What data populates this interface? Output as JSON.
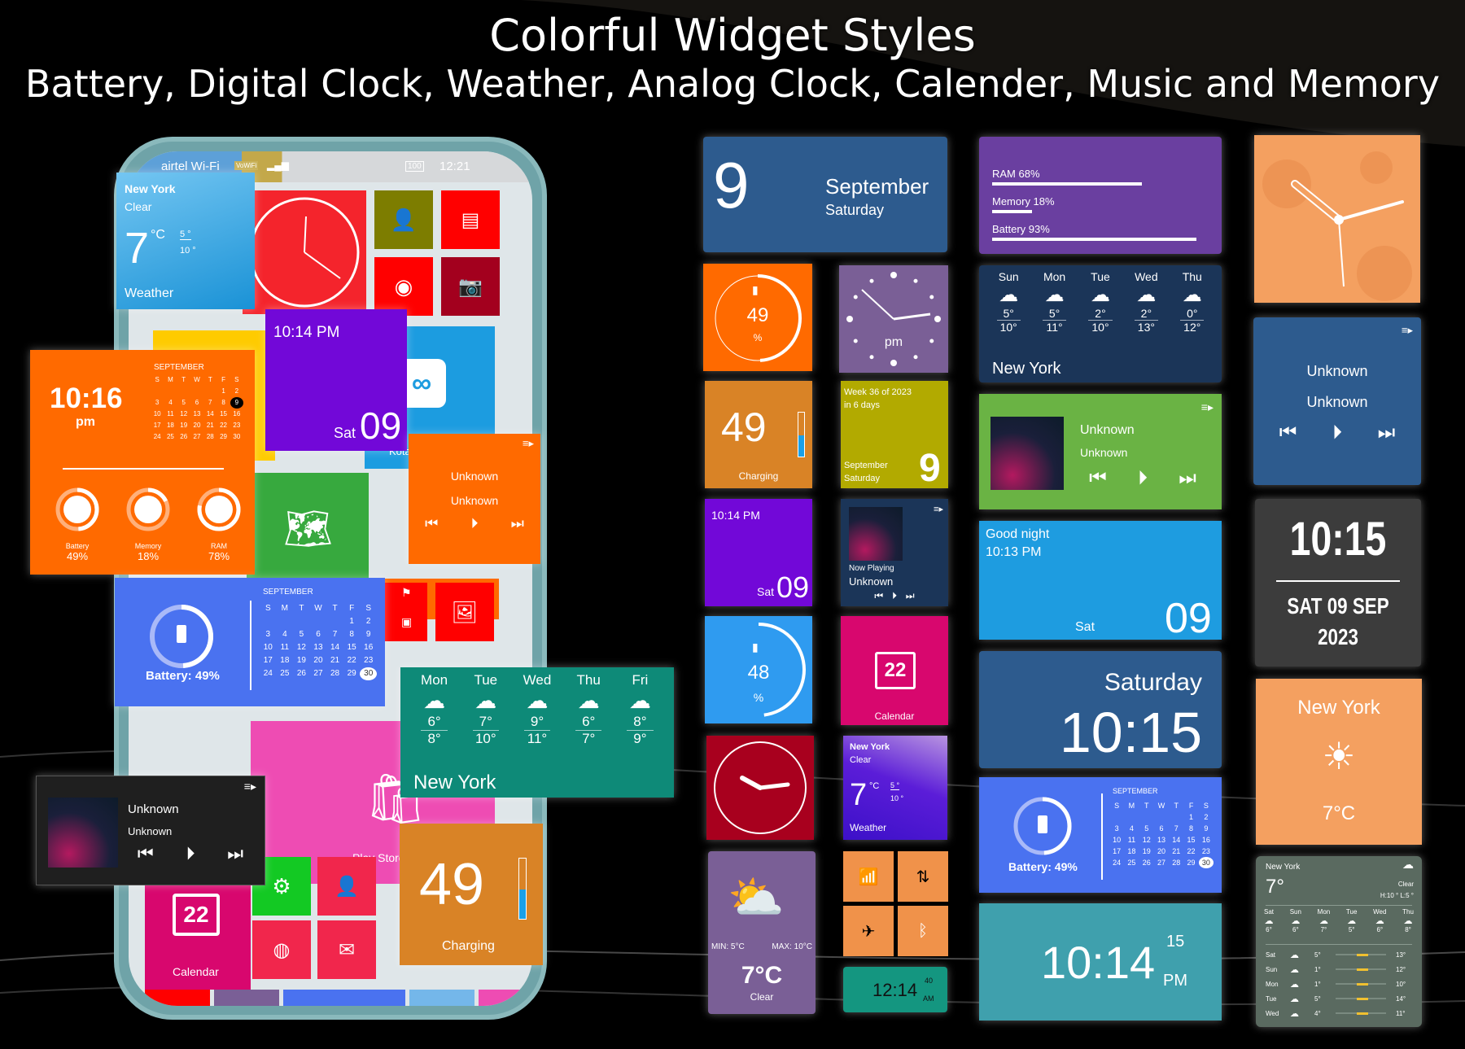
{
  "header": {
    "title": "Colorful Widget Styles",
    "subtitle": "Battery, Digital Clock, Weather, Analog Clock, Calender, Music and Memory"
  },
  "colors": {
    "background": "#000000",
    "orange": "#ff6a00",
    "purple": "#7208d8",
    "blue_calendar": "#4a72f0",
    "teal_weather": "#0e8a78",
    "navy": "#2d5b8e",
    "memory_purple": "#6a3fa0",
    "dark_navy": "#1b3558",
    "green_music": "#6ab344",
    "sky_blue": "#1e9ce0",
    "amber": "#d98326",
    "olive": "#b2aa00",
    "magenta": "#d8076e",
    "crimson": "#a8001e",
    "lavender": "#7a5f96",
    "peach": "#f4a060",
    "charcoal": "#3c3c3c",
    "slate_green": "#5a6a60",
    "teal_clock": "#3fa0ad",
    "green_clock": "#149680"
  },
  "phone": {
    "status_bar": {
      "carrier": "airtel Wi-Fi",
      "wifi_badge": "VoWiFi",
      "battery": "100",
      "time": "12:21"
    },
    "weather_widget": {
      "city": "New York",
      "condition": "Clear",
      "temp": "7",
      "unit": "°C",
      "low": "5 °",
      "high": "10 °",
      "label": "Weather"
    },
    "purple_clock": {
      "time": "10:14 PM",
      "day": "Sat",
      "date": "09"
    },
    "kotak_label": "Kotak Bank",
    "orange_widget": {
      "time": "10:16",
      "ampm": "pm",
      "month": "SEPTEMBER",
      "weekdays": [
        "S",
        "M",
        "T",
        "W",
        "T",
        "F",
        "S"
      ],
      "days": [
        "",
        "",
        "",
        "",
        "",
        "1",
        "2",
        "3",
        "4",
        "5",
        "6",
        "7",
        "8",
        "9",
        "10",
        "11",
        "12",
        "13",
        "14",
        "15",
        "16",
        "17",
        "18",
        "19",
        "20",
        "21",
        "22",
        "23",
        "24",
        "25",
        "26",
        "27",
        "28",
        "29",
        "30"
      ],
      "selected": "9",
      "stats": [
        {
          "label": "Battery",
          "value": "49%",
          "fraction": 0.49
        },
        {
          "label": "Memory",
          "value": "18%",
          "fraction": 0.18
        },
        {
          "label": "RAM",
          "value": "78%",
          "fraction": 0.78
        }
      ]
    },
    "maps_label": "Maps",
    "music_orange": {
      "title": "Unknown",
      "artist": "Unknown"
    },
    "battery_calendar": {
      "battery_label": "Battery: 49%",
      "battery_fraction": 0.49,
      "month": "SEPTEMBER",
      "weekdays": [
        "S",
        "M",
        "T",
        "W",
        "T",
        "F",
        "S"
      ],
      "days": [
        "",
        "",
        "",
        "",
        "",
        "1",
        "2",
        "3",
        "4",
        "5",
        "6",
        "7",
        "8",
        "9",
        "10",
        "11",
        "12",
        "13",
        "14",
        "15",
        "16",
        "17",
        "18",
        "19",
        "20",
        "21",
        "22",
        "23",
        "24",
        "25",
        "26",
        "27",
        "28",
        "29",
        "30"
      ],
      "selected": "30"
    },
    "forecast_teal": {
      "city": "New York",
      "days": [
        {
          "day": "Mon",
          "low": "6°",
          "high": "8°"
        },
        {
          "day": "Tue",
          "low": "7°",
          "high": "10°"
        },
        {
          "day": "Wed",
          "low": "9°",
          "high": "11°"
        },
        {
          "day": "Thu",
          "low": "6°",
          "high": "7°"
        },
        {
          "day": "Fri",
          "low": "8°",
          "high": "9°"
        }
      ]
    },
    "play_store_label": "Play Store",
    "music_dark": {
      "title": "Unknown",
      "artist": "Unknown"
    },
    "calendar_tile": {
      "date": "22",
      "label": "Calendar"
    },
    "battery_charging": {
      "value": "49",
      "label": "Charging",
      "fraction": 0.49
    }
  },
  "col1": {
    "date_widget": {
      "day": "9",
      "month": "September",
      "weekday": "Saturday"
    },
    "battery_ring": {
      "value": "49",
      "unit": "%",
      "fraction": 0.49
    },
    "battery_charging": {
      "value": "49",
      "label": "Charging",
      "fraction": 0.49
    },
    "purple_clock": {
      "time": "10:14 PM",
      "day": "Sat",
      "date": "09"
    },
    "battery_arc": {
      "value": "48",
      "unit": "%",
      "fraction": 0.48
    },
    "weather_card": {
      "min": "MIN: 5°C",
      "max": "MAX: 10°C",
      "temp": "7°C",
      "condition": "Clear"
    }
  },
  "col2": {
    "analog_pm": {
      "label": "pm"
    },
    "week_widget": {
      "week": "Week 36 of 2023",
      "in_days": "in 6 days",
      "month": "September",
      "weekday": "Saturday",
      "day": "9"
    },
    "now_playing": {
      "label": "Now Playing",
      "title": "Unknown"
    },
    "calendar_tile": {
      "date": "22",
      "label": "Calendar"
    },
    "weather_widget": {
      "city": "New York",
      "condition": "Clear",
      "temp": "7",
      "unit": "°C",
      "low": "5 °",
      "high": "10 °",
      "label": "Weather"
    },
    "toggles": [
      "wifi",
      "data",
      "airplane",
      "bluetooth"
    ],
    "digital_clock": {
      "time": "12:14",
      "seconds": "40",
      "ampm": "AM"
    }
  },
  "col3": {
    "memory_widget": {
      "bars": [
        {
          "label": "RAM 68%",
          "fraction": 0.68
        },
        {
          "label": "Memory 18%",
          "fraction": 0.18
        },
        {
          "label": "Battery 93%",
          "fraction": 0.93
        }
      ]
    },
    "forecast_navy": {
      "city": "New York",
      "days": [
        {
          "day": "Sun",
          "low": "5°",
          "high": "10°"
        },
        {
          "day": "Mon",
          "low": "5°",
          "high": "11°"
        },
        {
          "day": "Tue",
          "low": "2°",
          "high": "10°"
        },
        {
          "day": "Wed",
          "low": "2°",
          "high": "13°"
        },
        {
          "day": "Thu",
          "low": "0°",
          "high": "12°"
        }
      ]
    },
    "music_green": {
      "title": "Unknown",
      "artist": "Unknown"
    },
    "greeting_widget": {
      "greeting": "Good night",
      "time": "10:13 PM",
      "day": "Sat",
      "date": "09"
    },
    "saturday_clock": {
      "weekday": "Saturday",
      "time": "10:15"
    },
    "battery_calendar": {
      "battery_label": "Battery: 49%",
      "battery_fraction": 0.49,
      "month": "SEPTEMBER",
      "weekdays": [
        "S",
        "M",
        "T",
        "W",
        "T",
        "F",
        "S"
      ],
      "days": [
        "",
        "",
        "",
        "",
        "",
        "1",
        "2",
        "3",
        "4",
        "5",
        "6",
        "7",
        "8",
        "9",
        "10",
        "11",
        "12",
        "13",
        "14",
        "15",
        "16",
        "17",
        "18",
        "19",
        "20",
        "21",
        "22",
        "23",
        "24",
        "25",
        "26",
        "27",
        "28",
        "29",
        "30"
      ],
      "selected": "30"
    },
    "big_clock": {
      "time": "10:14",
      "seconds": "15",
      "ampm": "PM"
    }
  },
  "col4": {
    "music_blue": {
      "title": "Unknown",
      "artist": "Unknown"
    },
    "condensed_clock": {
      "time": "10:15",
      "date": "SAT 09 SEP",
      "year": "2023"
    },
    "weather_simple": {
      "city": "New York",
      "temp": "7°C"
    },
    "weather_detail": {
      "city": "New York",
      "temp": "7°",
      "condition": "Clear",
      "hilo": "H:10 ° L:5 °",
      "hourly": [
        {
          "day": "Sat",
          "temp": "6°"
        },
        {
          "day": "Sun",
          "temp": "6°"
        },
        {
          "day": "Mon",
          "temp": "7°"
        },
        {
          "day": "Tue",
          "temp": "5°"
        },
        {
          "day": "Wed",
          "temp": "6°"
        },
        {
          "day": "Thu",
          "temp": "8°"
        }
      ],
      "daily": [
        {
          "day": "Sat",
          "low": "5°",
          "high": "13°"
        },
        {
          "day": "Sun",
          "low": "1°",
          "high": "12°"
        },
        {
          "day": "Mon",
          "low": "1°",
          "high": "10°"
        },
        {
          "day": "Tue",
          "low": "5°",
          "high": "14°"
        },
        {
          "day": "Wed",
          "low": "4°",
          "high": "11°"
        }
      ]
    }
  }
}
